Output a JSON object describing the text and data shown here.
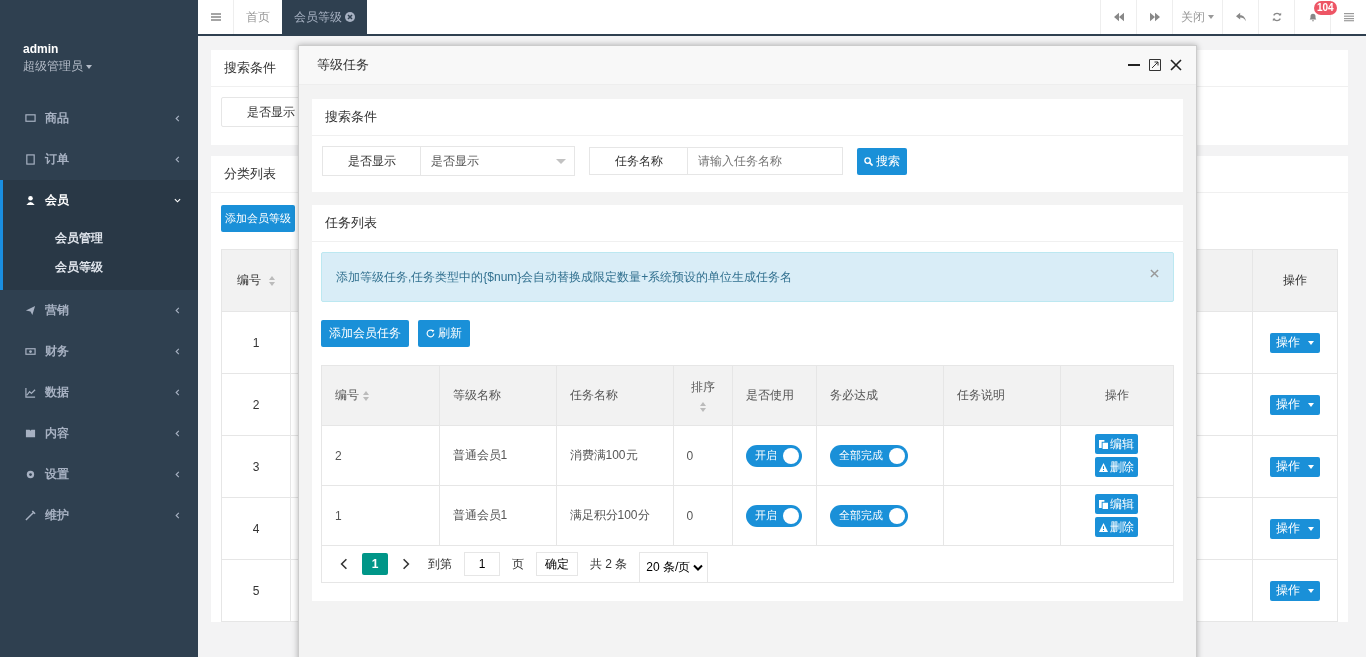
{
  "sidebar": {
    "user": {
      "name": "admin",
      "role": "超级管理员"
    },
    "items": [
      {
        "label": "商品",
        "selected": false,
        "expanded": false
      },
      {
        "label": "订单",
        "selected": false,
        "expanded": false
      },
      {
        "label": "会员",
        "selected": true,
        "expanded": true,
        "children": [
          {
            "label": "会员管理"
          },
          {
            "label": "会员等级"
          }
        ]
      },
      {
        "label": "营销",
        "selected": false,
        "expanded": false
      },
      {
        "label": "财务",
        "selected": false,
        "expanded": false
      },
      {
        "label": "数据",
        "selected": false,
        "expanded": false
      },
      {
        "label": "内容",
        "selected": false,
        "expanded": false
      },
      {
        "label": "设置",
        "selected": false,
        "expanded": false
      },
      {
        "label": "维护",
        "selected": false,
        "expanded": false
      }
    ]
  },
  "topbar": {
    "tabs": [
      {
        "label": "首页",
        "selected": false
      },
      {
        "label": "会员等级",
        "selected": true
      }
    ],
    "close_menu": "关闭",
    "notifications": "104"
  },
  "page": {
    "search_panel": {
      "title": "搜索条件",
      "field_label": "是否显示"
    },
    "list_panel": {
      "title": "分类列表",
      "add_button": "添加会员等级",
      "columns": [
        "编号",
        "操作"
      ],
      "rows": [
        {
          "id": "1",
          "action": "操作"
        },
        {
          "id": "2",
          "action": "操作"
        },
        {
          "id": "3",
          "action": "操作"
        },
        {
          "id": "4",
          "action": "操作"
        },
        {
          "id": "5",
          "action": "操作"
        }
      ]
    }
  },
  "dialog": {
    "title": "等级任务",
    "search": {
      "title": "搜索条件",
      "select_label": "是否显示",
      "select_value": "是否显示",
      "name_label": "任务名称",
      "name_placeholder": "请输入任务名称",
      "search_button": "搜索"
    },
    "list": {
      "title": "任务列表",
      "alert": "添加等级任务,任务类型中的{$num}会自动替换成限定数量+系统预设的单位生成任务名",
      "add_button": "添加会员任务",
      "refresh_button": "刷新",
      "columns": [
        {
          "label": "编号",
          "sortable": true
        },
        {
          "label": "等级名称",
          "sortable": false
        },
        {
          "label": "任务名称",
          "sortable": false
        },
        {
          "label": "排序",
          "sortable": true
        },
        {
          "label": "是否使用",
          "sortable": false
        },
        {
          "label": "务必达成",
          "sortable": false
        },
        {
          "label": "任务说明",
          "sortable": false
        },
        {
          "label": "操作",
          "sortable": false
        }
      ],
      "rows": [
        {
          "id": "2",
          "level": "普通会员1",
          "task": "消费满100元",
          "sort": "0",
          "use": {
            "label": "开启",
            "on": true
          },
          "must": {
            "label": "全部完成",
            "on": true
          },
          "edit": "编辑",
          "delete": "删除"
        },
        {
          "id": "1",
          "level": "普通会员1",
          "task": "满足积分100分",
          "sort": "0",
          "use": {
            "label": "开启",
            "on": true
          },
          "must": {
            "label": "全部完成",
            "on": true
          },
          "edit": "编辑",
          "delete": "删除"
        }
      ],
      "pagination": {
        "pages": [
          {
            "label": "1",
            "selected": true
          }
        ],
        "goto_label": "到第",
        "goto_value": "1",
        "page_unit": "页",
        "confirm": "确定",
        "total": "共 2 条",
        "page_size": "20 条/页"
      }
    }
  }
}
